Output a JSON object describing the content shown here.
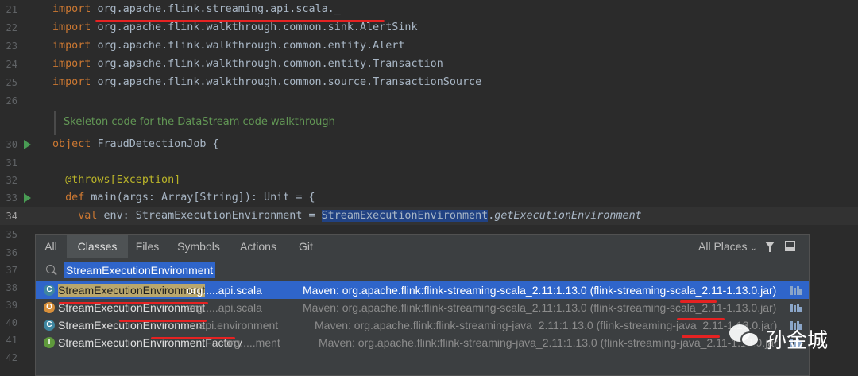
{
  "editor": {
    "lines": [
      {
        "no": "21",
        "code": [
          {
            "t": "import ",
            "c": "kw"
          },
          {
            "t": "org.apache.flink.streaming.api.scala._",
            "c": ""
          }
        ]
      },
      {
        "no": "22",
        "code": [
          {
            "t": "import ",
            "c": "kw"
          },
          {
            "t": "org.apache.flink.walkthrough.common.sink.AlertSink",
            "c": ""
          }
        ]
      },
      {
        "no": "23",
        "code": [
          {
            "t": "import ",
            "c": "kw"
          },
          {
            "t": "org.apache.flink.walkthrough.common.entity.Alert",
            "c": ""
          }
        ]
      },
      {
        "no": "24",
        "code": [
          {
            "t": "import ",
            "c": "kw"
          },
          {
            "t": "org.apache.flink.walkthrough.common.entity.Transaction",
            "c": ""
          }
        ]
      },
      {
        "no": "25",
        "code": [
          {
            "t": "import ",
            "c": "kw"
          },
          {
            "t": "org.apache.flink.walkthrough.common.source.TransactionSource",
            "c": ""
          }
        ]
      },
      {
        "no": "26",
        "code": []
      },
      {
        "no": "",
        "code": []
      },
      {
        "no": "30",
        "code": [
          {
            "t": "object ",
            "c": "kw"
          },
          {
            "t": "FraudDetectionJob {",
            "c": ""
          }
        ]
      },
      {
        "no": "31",
        "code": []
      },
      {
        "no": "32",
        "code": [
          {
            "t": "  @throws[Exception]",
            "c": "ann"
          }
        ]
      },
      {
        "no": "33",
        "code": [
          {
            "t": "  def ",
            "c": "kw"
          },
          {
            "t": "main(args: Array[String]): Unit = {",
            "c": ""
          }
        ]
      },
      {
        "no": "34",
        "code": [
          {
            "t": "    val ",
            "c": "kw"
          },
          {
            "t": "env: StreamExecutionEnvironment = ",
            "c": ""
          },
          {
            "t": "StreamExecutionEnvironment",
            "c": "sel"
          },
          {
            "t": ".",
            "c": ""
          },
          {
            "t": "getExecutionEnvironment",
            "c": "it"
          }
        ]
      },
      {
        "no": "35",
        "code": []
      },
      {
        "no": "36",
        "code": []
      },
      {
        "no": "37",
        "code": []
      },
      {
        "no": "38",
        "code": []
      },
      {
        "no": "39",
        "code": []
      },
      {
        "no": "40",
        "code": []
      },
      {
        "no": "41",
        "code": []
      },
      {
        "no": "42",
        "code": []
      }
    ],
    "doc_comment": "Skeleton code for the DataStream code walkthrough"
  },
  "popup": {
    "tabs": [
      "All",
      "Classes",
      "Files",
      "Symbols",
      "Actions",
      "Git"
    ],
    "active_tab": "Classes",
    "places_label": "All Places",
    "search_value": "StreamExecutionEnvironment",
    "results": [
      {
        "icon": "C",
        "kind": "class",
        "name_hl": "StreamExecutionEnvironment",
        "name_rest": "",
        "pkg": "org.....api.scala",
        "location": "Maven: org.apache.flink:flink-streaming-scala_2.11:1.13.0 (flink-streaming-scala_2.11-1.13.0.jar)",
        "selected": true
      },
      {
        "icon": "O",
        "kind": "object",
        "name_hl": "StreamExecutionEnvironment",
        "name_rest": "",
        "pkg": "org.....api.scala",
        "location": "Maven: org.apache.flink:flink-streaming-scala_2.11:1.13.0 (flink-streaming-scala_2.11-1.13.0.jar)",
        "selected": false
      },
      {
        "icon": "C",
        "kind": "class",
        "name_hl": "StreamExecutionEnvironment",
        "name_rest": "",
        "pkg": "....api.environment",
        "location": "Maven: org.apache.flink:flink-streaming-java_2.11:1.13.0 (flink-streaming-java_2.11-1.13.0.jar)",
        "selected": false
      },
      {
        "icon": "I",
        "kind": "interface",
        "name_hl": "StreamExecutionEnvironment",
        "name_rest": "Factory",
        "pkg": "org.....ment",
        "location": "Maven: org.apache.flink:flink-streaming-java_2.11:1.13.0 (flink-streaming-java_2.11-1.13.0.jar)",
        "selected": false
      }
    ]
  },
  "watermark": {
    "text": "孙金城"
  },
  "colors": {
    "accent": "#2f65ca",
    "annotation_red": "#e52222",
    "background": "#2b2b2b"
  }
}
